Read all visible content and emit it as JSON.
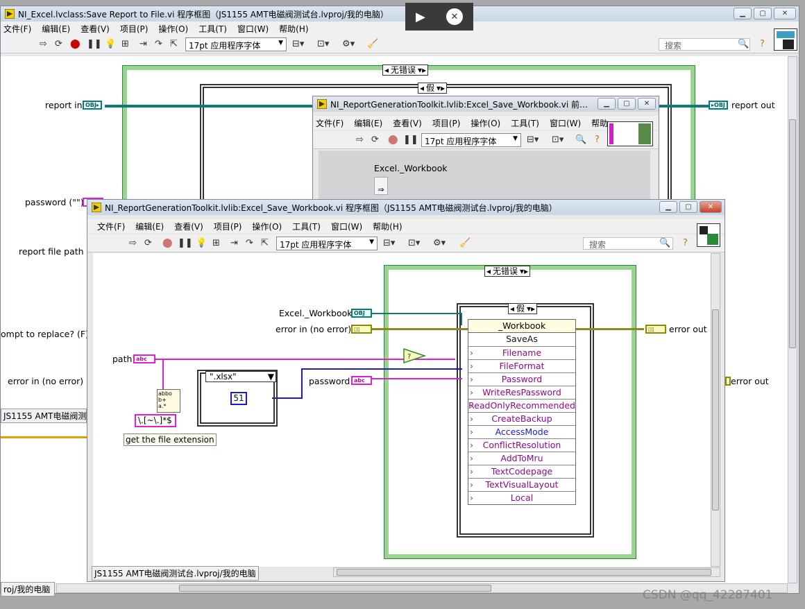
{
  "back_window": {
    "title": "NI_Excel.lvclass:Save Report to File.vi 程序框图（JS1155 AMT电磁阀测试台.lvproj/我的电脑）",
    "menu": [
      "文件(F)",
      "编辑(E)",
      "查看(V)",
      "项目(P)",
      "操作(O)",
      "工具(T)",
      "窗口(W)",
      "帮助(H)"
    ],
    "font": "17pt 应用程序字体",
    "search_placeholder": "搜索",
    "case_outer": "无错误",
    "case_inner": "假",
    "labels": {
      "report_in": "report in",
      "report_out": "report out",
      "password": "password (\"\")",
      "report_file_path": "report file path",
      "prompt_replace": "ompt to replace? (F)",
      "error_in": "error in (no error)",
      "error_out": "error out"
    },
    "status_project": "JS1155 AMT电磁阀测",
    "status_project2": "roj/我的电脑"
  },
  "overlay": {
    "play_icon": "▶",
    "close_icon": "✕"
  },
  "mid_window": {
    "title": "NI_ReportGenerationToolkit.lvlib:Excel_Save_Workbook.vi 前…",
    "menu": [
      "文件(F)",
      "编辑(E)",
      "查看(V)",
      "项目(P)",
      "操作(O)",
      "工具(T)",
      "窗口(W)",
      "帮助"
    ],
    "font": "17pt 应用程序字体",
    "control_label": "Excel._Workbook"
  },
  "front_window": {
    "title": "NI_ReportGenerationToolkit.lvlib:Excel_Save_Workbook.vi 程序框图（JS1155 AMT电磁阀测试台.lvproj/我的电脑）",
    "menu": [
      "文件(F)",
      "编辑(E)",
      "查看(V)",
      "项目(P)",
      "操作(O)",
      "工具(T)",
      "窗口(W)",
      "帮助(H)"
    ],
    "font": "17pt 应用程序字体",
    "search_placeholder": "搜索",
    "case_outer": "无错误",
    "case_inner": "假",
    "case_ext": "\".xlsx\"",
    "const_51": "51",
    "regex": "\\.[~\\.]*$",
    "comment": "get the file extension",
    "labels": {
      "excel_workbook": "Excel._Workbook",
      "error_in": "error in (no error)",
      "error_out": "error out",
      "path": "path",
      "password": "password"
    },
    "terminals": {
      "obj": "OBJ",
      "str": "abc",
      "err": "▯▯"
    },
    "property_node": {
      "class": "_Workbook",
      "method": "SaveAs",
      "params": [
        "Filename",
        "FileFormat",
        "Password",
        "WriteResPassword",
        "ReadOnlyRecommended",
        "CreateBackup",
        "AccessMode",
        "ConflictResolution",
        "AddToMru",
        "TextCodepage",
        "TextVisualLayout",
        "Local"
      ]
    },
    "status_project": "JS1155 AMT电磁阀测试台.lvproj/我的电脑"
  },
  "watermark": "CSDN @qq_42287401"
}
